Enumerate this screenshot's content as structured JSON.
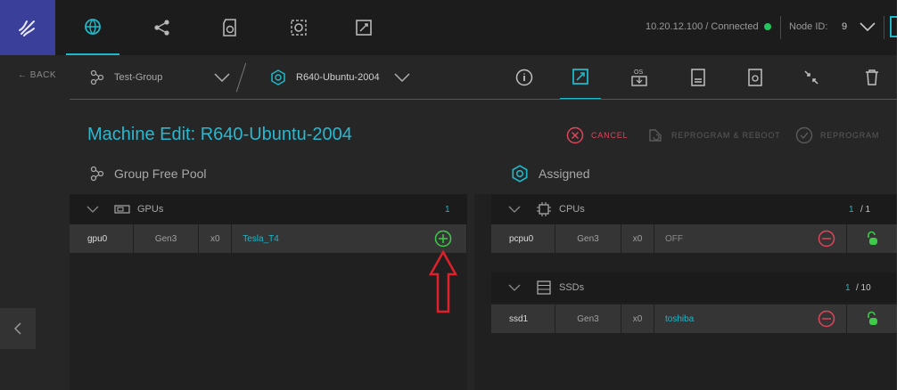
{
  "topbar": {
    "connection_text": "10.20.12.100 / Connected",
    "node_id_label": "Node ID:",
    "node_id_value": "9",
    "status_color": "#22c55e"
  },
  "subbar": {
    "back_label": "← BACK",
    "group_name": "Test-Group",
    "machine_name": "R640-Ubuntu-2004"
  },
  "main": {
    "title": "Machine Edit: R640-Ubuntu-2004",
    "cancel_label": "CANCEL",
    "reprogram_reboot_label": "REPROGRAM & REBOOT",
    "reprogram_label": "REPROGRAM",
    "left_header": "Group Free Pool",
    "right_header": "Assigned"
  },
  "free_pool": {
    "gpu_section": {
      "label": "GPUs",
      "count": "1",
      "rows": [
        {
          "name": "gpu0",
          "gen": "Gen3",
          "width": "x0",
          "model": "Tesla_T4"
        }
      ]
    }
  },
  "assigned": {
    "cpu_section": {
      "label": "CPUs",
      "count_assigned": "1",
      "count_total": "/ 1",
      "rows": [
        {
          "name": "pcpu0",
          "gen": "Gen3",
          "width": "x0",
          "model": "OFF"
        }
      ]
    },
    "ssd_section": {
      "label": "SSDs",
      "count_assigned": "1",
      "count_total": "/ 10",
      "rows": [
        {
          "name": "ssd1",
          "gen": "Gen3",
          "width": "x0",
          "model": "toshiba"
        }
      ]
    }
  },
  "colors": {
    "accent": "#1fb8c9",
    "cancel": "#e0455a",
    "add": "#3ecb4a",
    "annotation_arrow": "#e0202a"
  }
}
